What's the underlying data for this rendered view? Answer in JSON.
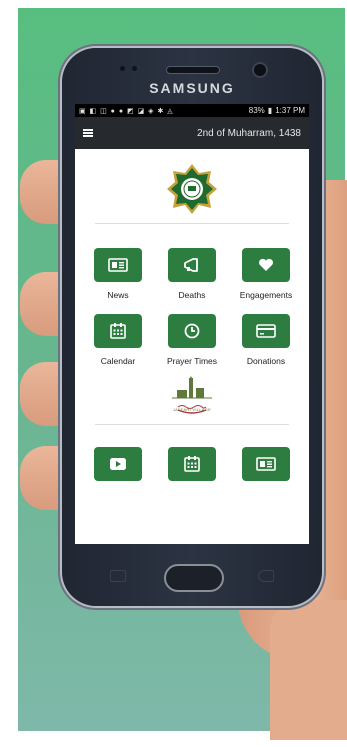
{
  "device": {
    "brand": "SAMSUNG"
  },
  "status_bar": {
    "battery": "83%",
    "time": "1:37 PM"
  },
  "app_bar": {
    "date": "2nd of Muharram, 1438"
  },
  "row1": [
    {
      "label": "News",
      "icon": "newspaper-icon"
    },
    {
      "label": "Deaths",
      "icon": "megaphone-icon"
    },
    {
      "label": "Engagements",
      "icon": "heart-icon"
    }
  ],
  "row2": [
    {
      "label": "Calendar",
      "icon": "calendar-icon"
    },
    {
      "label": "Prayer Times",
      "icon": "clock-icon"
    },
    {
      "label": "Donations",
      "icon": "credit-card-icon"
    }
  ],
  "village_logo_text": "JAFFARI VILLAGE",
  "row3": [
    {
      "icon": "video-play-icon"
    },
    {
      "icon": "calendar-icon"
    },
    {
      "icon": "newspaper-icon"
    }
  ],
  "colors": {
    "tile": "#2e7d40",
    "app_bar": "#262a2e",
    "background": "#5dba85"
  }
}
